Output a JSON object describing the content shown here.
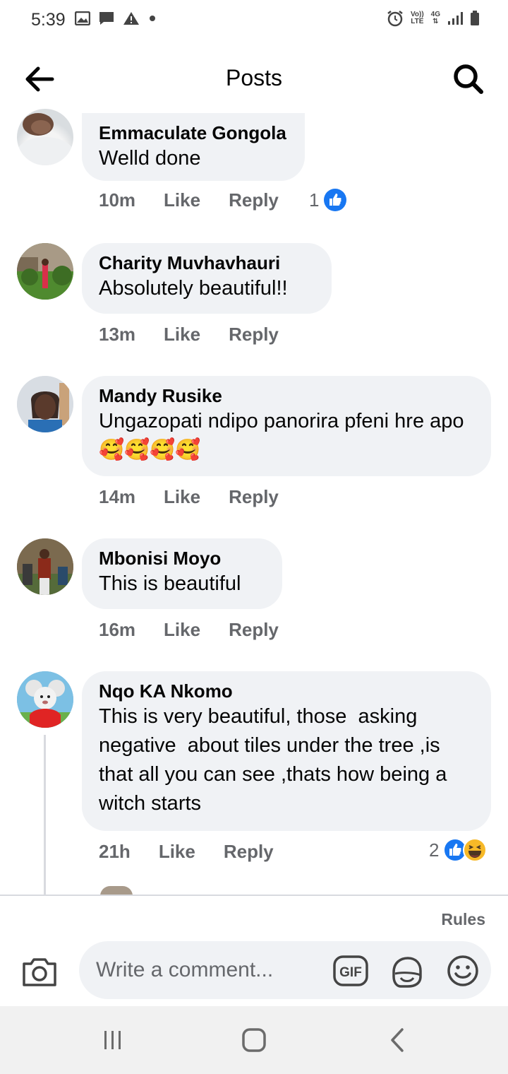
{
  "status_bar": {
    "time": "5:39",
    "left_icons": [
      "image-icon",
      "message-icon",
      "warning-icon",
      "dot-icon"
    ],
    "right_icons": [
      "alarm-icon",
      "volte-icon",
      "4g-icon",
      "signal-icon",
      "battery-icon"
    ],
    "volte_label_top": "Vo))",
    "volte_label_bottom": "LTE",
    "network_label": "4G"
  },
  "header": {
    "title": "Posts"
  },
  "comments": [
    {
      "author": "Emmaculate Gongola",
      "text": "Welld done",
      "time": "10m",
      "like_label": "Like",
      "reply_label": "Reply",
      "reaction_count": "1",
      "reactions": [
        "like-reaction-icon"
      ]
    },
    {
      "author": "Charity Muvhavhauri",
      "text": "Absolutely beautiful!!",
      "time": "13m",
      "like_label": "Like",
      "reply_label": "Reply"
    },
    {
      "author": "Mandy Rusike",
      "text": "Ungazopati ndipo panorira pfeni hre apo🥰🥰🥰🥰",
      "time": "14m",
      "like_label": "Like",
      "reply_label": "Reply"
    },
    {
      "author": "Mbonisi Moyo",
      "text": "This is beautiful",
      "time": "16m",
      "like_label": "Like",
      "reply_label": "Reply"
    },
    {
      "author": "Nqo KA Nkomo",
      "text": "This is very beautiful, those  asking negative  about tiles under the tree ,is that all you can see ,thats how being a witch starts",
      "time": "21h",
      "like_label": "Like",
      "reply_label": "Reply",
      "reaction_count": "2",
      "reactions": [
        "like-reaction-icon",
        "haha-reaction-icon"
      ]
    }
  ],
  "composer": {
    "rules_label": "Rules",
    "placeholder": "Write a comment..."
  },
  "colors": {
    "like_blue": "#1877f2",
    "bubble_bg": "#f0f2f5",
    "meta_gray": "#65676b"
  }
}
